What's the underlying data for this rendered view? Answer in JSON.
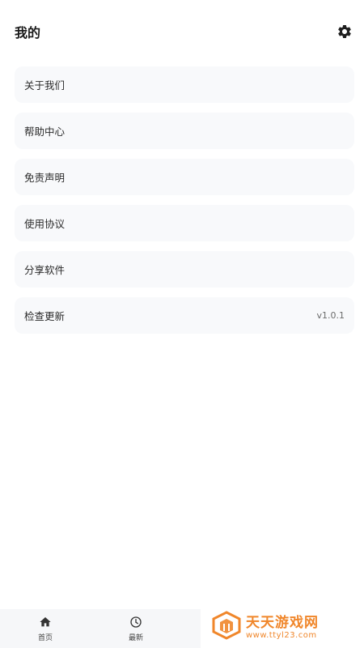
{
  "header": {
    "title": "我的",
    "settings_icon": "gear-icon"
  },
  "menu": {
    "items": [
      {
        "label": "关于我们"
      },
      {
        "label": "帮助中心"
      },
      {
        "label": "免责声明"
      },
      {
        "label": "使用协议"
      },
      {
        "label": "分享软件"
      },
      {
        "label": "检查更新",
        "value": "v1.0.1"
      }
    ]
  },
  "bottom_nav": {
    "tabs": [
      {
        "label": "首页",
        "icon": "home-icon"
      },
      {
        "label": "最新",
        "icon": "clock-icon"
      }
    ]
  },
  "watermark": {
    "title": "天天游戏网",
    "url": "www.ttyl23.com",
    "color": "#f0862a"
  }
}
